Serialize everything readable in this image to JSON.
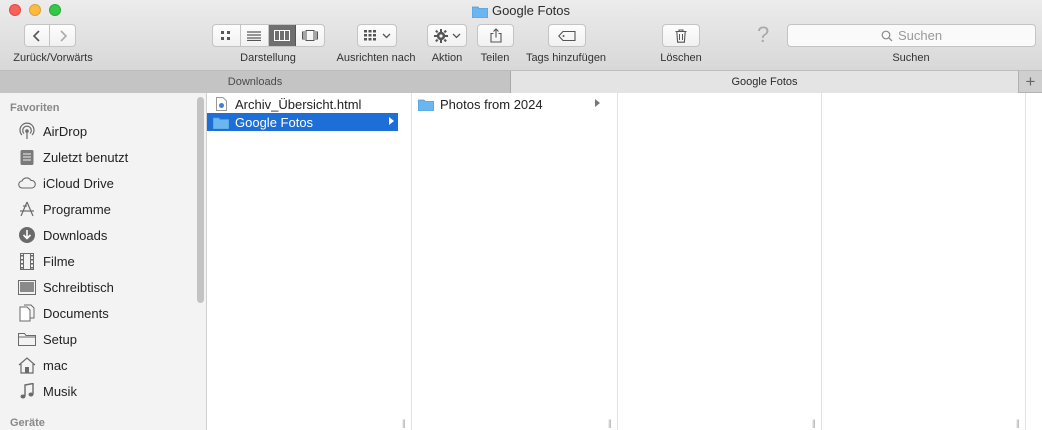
{
  "window": {
    "title": "Google Fotos"
  },
  "toolbar": {
    "back_forward_label": "Zurück/Vorwärts",
    "view_label": "Darstellung",
    "arrange_label": "Ausrichten nach",
    "action_label": "Aktion",
    "share_label": "Teilen",
    "tags_label": "Tags hinzufügen",
    "delete_label": "Löschen",
    "search_label": "Suchen",
    "search_placeholder": "Suchen",
    "help_glyph": "?"
  },
  "tabs": [
    {
      "label": "Downloads",
      "active": false
    },
    {
      "label": "Google Fotos",
      "active": true
    }
  ],
  "tab_add_glyph": "+",
  "sidebar": {
    "favorites_header": "Favoriten",
    "devices_header": "Geräte",
    "items": [
      {
        "label": "AirDrop",
        "icon": "airdrop-icon"
      },
      {
        "label": "Zuletzt benutzt",
        "icon": "recents-icon"
      },
      {
        "label": "iCloud Drive",
        "icon": "cloud-icon"
      },
      {
        "label": "Programme",
        "icon": "applications-icon"
      },
      {
        "label": "Downloads",
        "icon": "download-icon"
      },
      {
        "label": "Filme",
        "icon": "film-icon"
      },
      {
        "label": "Schreibtisch",
        "icon": "desktop-icon"
      },
      {
        "label": "Documents",
        "icon": "document-icon"
      },
      {
        "label": "Setup",
        "icon": "folder-icon"
      },
      {
        "label": "mac",
        "icon": "home-icon"
      },
      {
        "label": "Musik",
        "icon": "music-icon"
      }
    ]
  },
  "columns": {
    "col1": [
      {
        "label": "Archiv_Übersicht.html",
        "icon": "html-file-icon",
        "selected": false,
        "has_children": false
      },
      {
        "label": "Google Fotos",
        "icon": "folder-icon",
        "selected": true,
        "has_children": true
      }
    ],
    "col2": [
      {
        "label": "Photos from 2024",
        "icon": "folder-icon",
        "selected": false,
        "has_children": true
      }
    ]
  },
  "colors": {
    "selection": "#1e6ed8",
    "folder": "#6cb6f0"
  }
}
